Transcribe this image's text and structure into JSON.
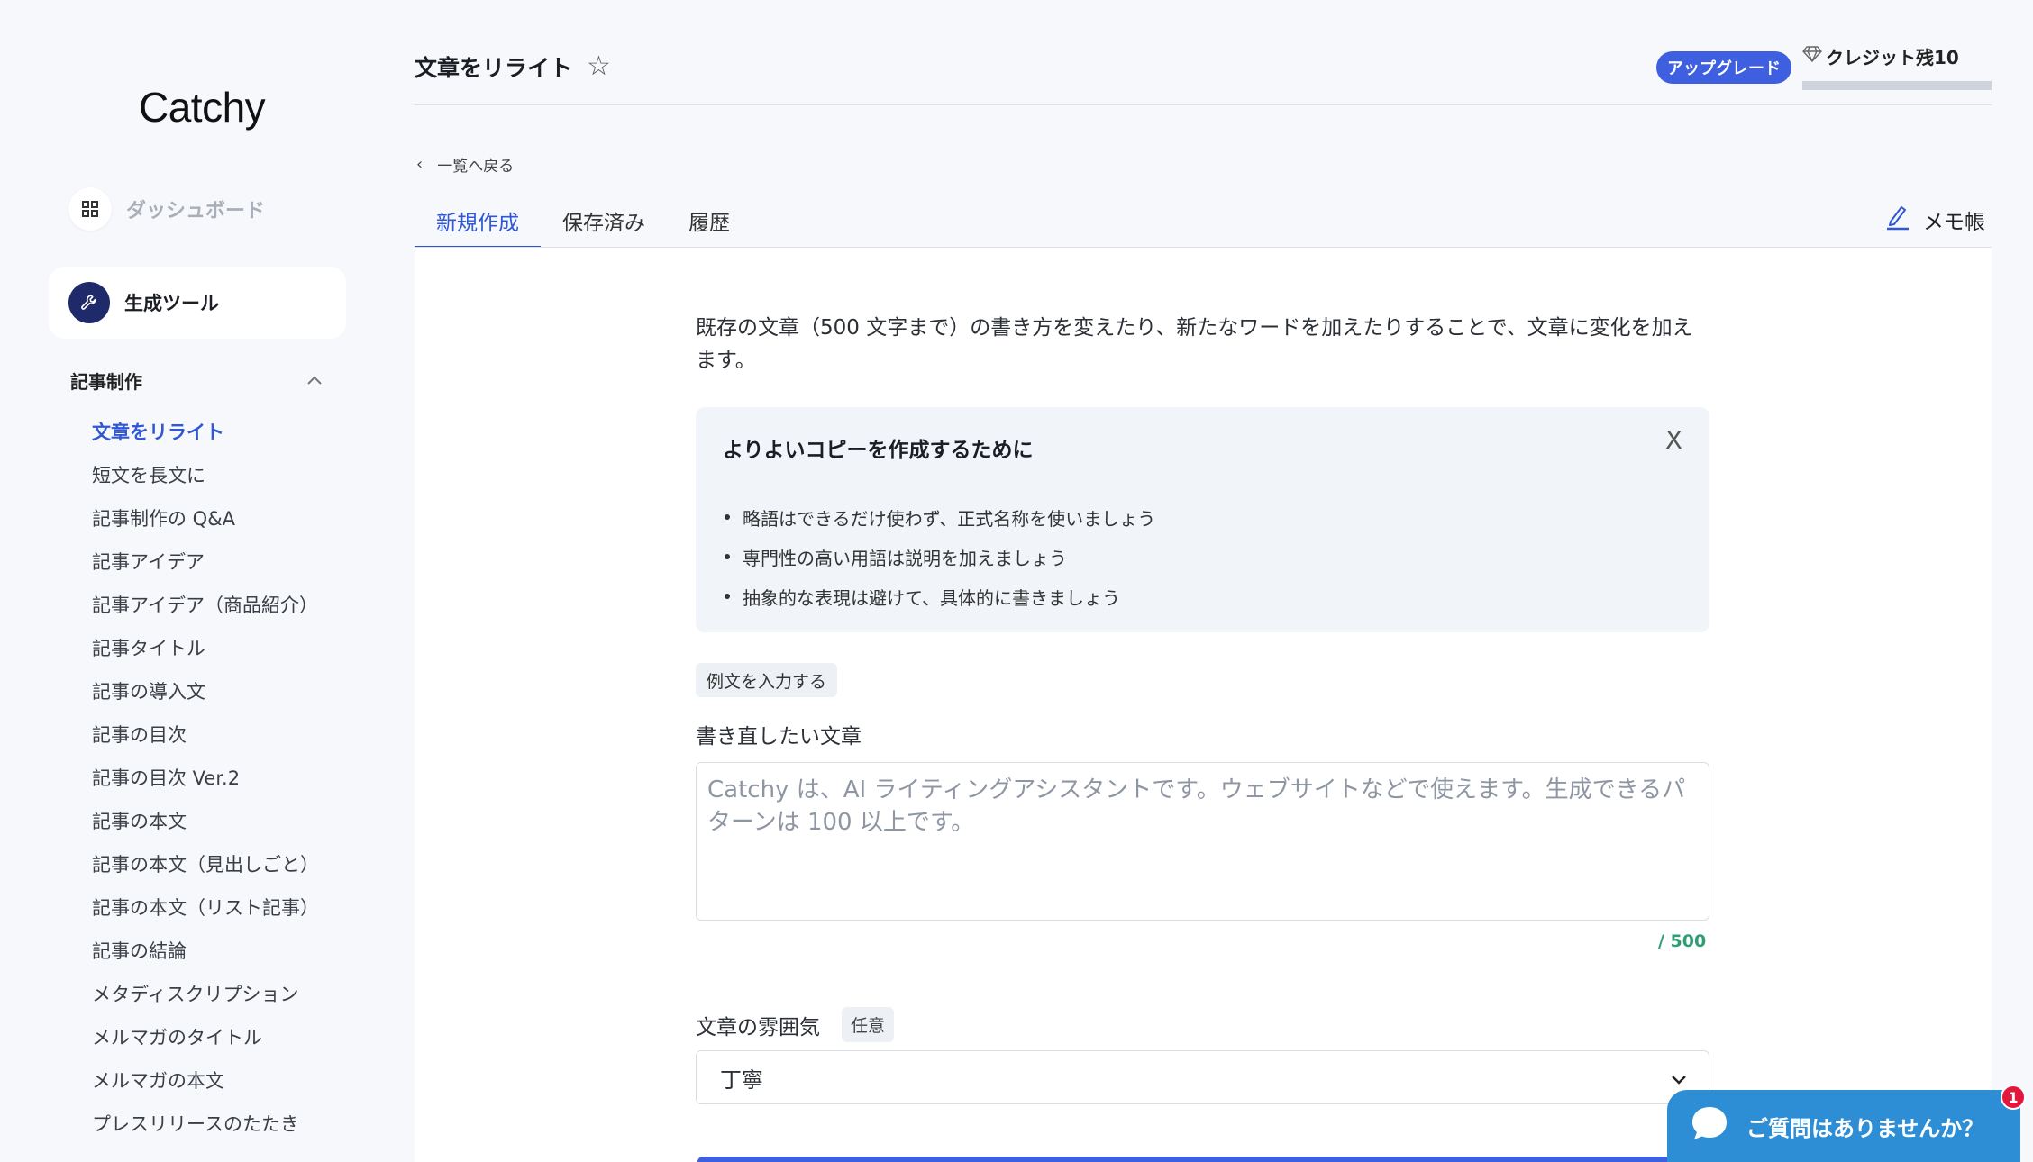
{
  "sidebar": {
    "logo": "Catchy",
    "dashboard_label": "ダッシュボード",
    "tools_label": "生成ツール",
    "section_label": "記事制作",
    "items": [
      "文章をリライト",
      "短文を長文に",
      "記事制作の Q&A",
      "記事アイデア",
      "記事アイデア（商品紹介）",
      "記事タイトル",
      "記事の導入文",
      "記事の目次",
      "記事の目次 Ver.2",
      "記事の本文",
      "記事の本文（見出しごと）",
      "記事の本文（リスト記事）",
      "記事の結論",
      "メタディスクリプション",
      "メルマガのタイトル",
      "メルマガの本文",
      "プレスリリースのたたき"
    ],
    "active_index": 0
  },
  "header": {
    "title": "文章をリライト",
    "star": "☆",
    "upgrade_label": "アップグレード",
    "credit_label": "クレジット残10"
  },
  "back_link": "一覧へ戻る",
  "tabs": [
    "新規作成",
    "保存済み",
    "履歴"
  ],
  "memo_label": "メモ帳",
  "main": {
    "description": "既存の文章（500 文字まで）の書き方を変えたり、新たなワードを加えたりすることで、文章に変化を加えます。",
    "tips": {
      "title": "よりよいコピーを作成するために",
      "close": "X",
      "items": [
        "略語はできるだけ使わず、正式名称を使いましょう",
        "専門性の高い用語は説明を加えましょう",
        "抽象的な表現は避けて、具体的に書きましょう"
      ]
    },
    "example_button": "例文を入力する",
    "field_label": "書き直したい文章",
    "placeholder": "Catchy は、AI ライティングアシスタントです。ウェブサイトなどで使えます。生成できるパターンは 100 以上です。",
    "counter": "/ 500",
    "tone_label": "文章の雰囲気",
    "tone_optional": "任意",
    "tone_value": "丁寧"
  },
  "chat": {
    "label": "ご質問はありませんか？",
    "badge": "1"
  },
  "colors": {
    "accent": "#3057d5",
    "upgrade": "#3d5fe0",
    "chat": "#2d8ed6",
    "counter": "#2f9e72",
    "badge": "#e3173e"
  }
}
